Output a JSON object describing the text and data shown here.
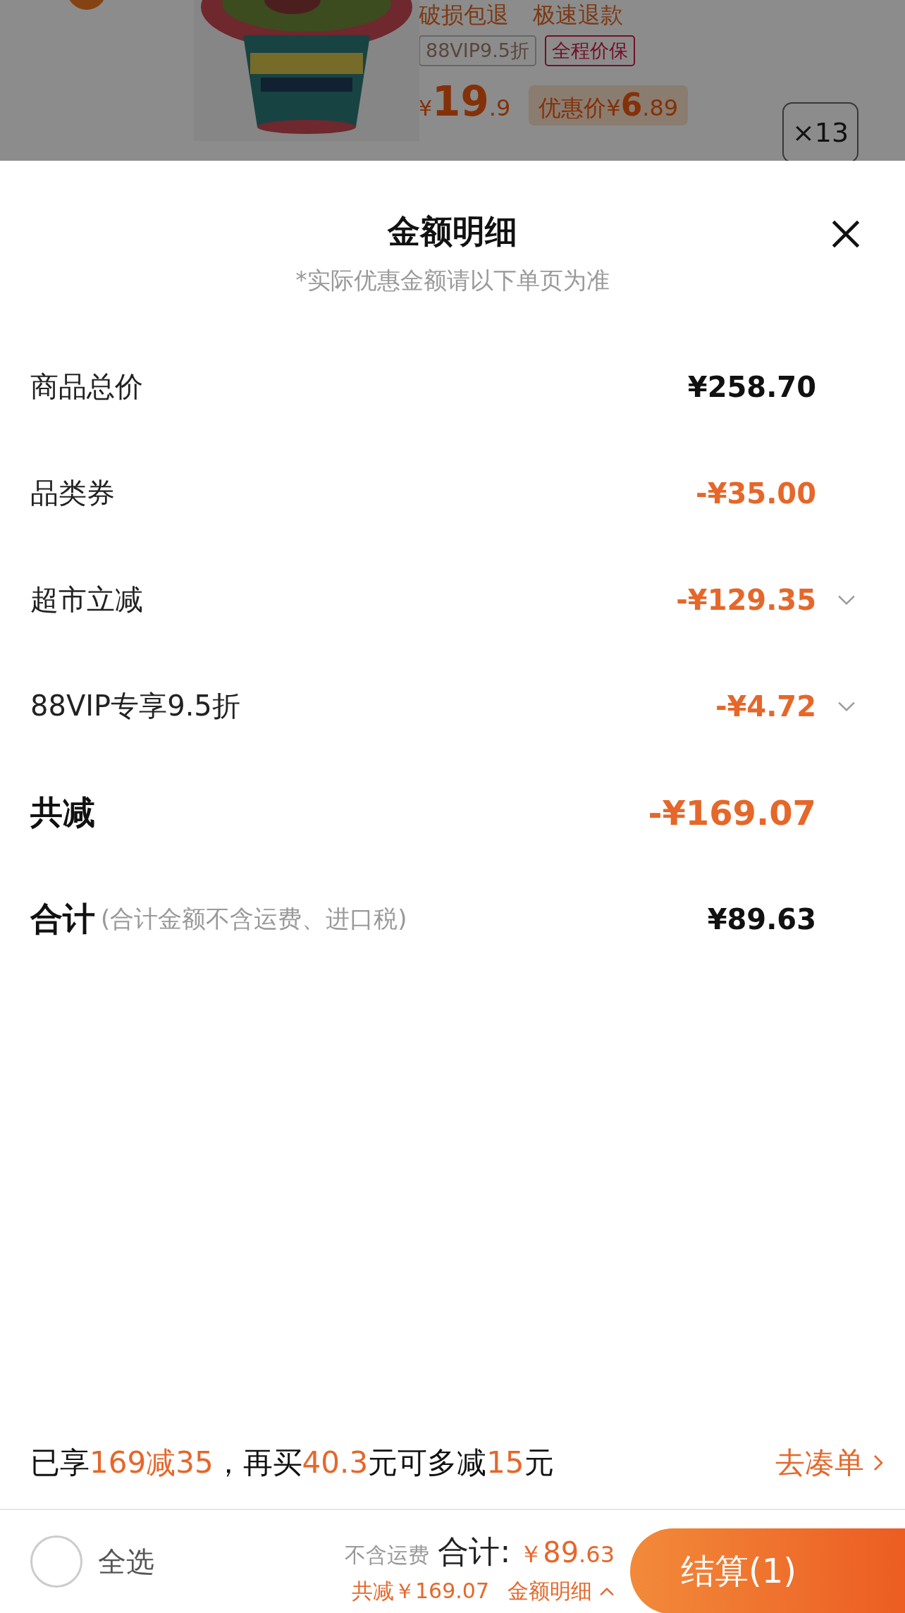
{
  "background_page": {
    "service_tags": [
      "破损包退",
      "极速退款"
    ],
    "badges": [
      {
        "text": "88VIP9.5折",
        "kind": "vip"
      },
      {
        "text": "全程价保",
        "kind": "guarantee"
      }
    ],
    "price": {
      "currency": "¥",
      "integer": "19",
      "decimal": ".9"
    },
    "discount_price": {
      "label": "优惠价",
      "currency": "¥",
      "integer": "6",
      "decimal": ".89"
    },
    "quantity": "×13"
  },
  "sheet": {
    "title": "金额明细",
    "subtitle": "*实际优惠金额请以下单页为准",
    "rows": [
      {
        "label": "商品总价",
        "value": "¥258.70",
        "kind": "price",
        "expandable": false
      },
      {
        "label": "品类券",
        "value": "-¥35.00",
        "kind": "discount",
        "expandable": false
      },
      {
        "label": "超市立减",
        "value": "-¥129.35",
        "kind": "discount",
        "expandable": true
      },
      {
        "label": "88VIP专享9.5折",
        "value": "-¥4.72",
        "kind": "discount",
        "expandable": true
      },
      {
        "label": "共减",
        "value": "-¥169.07",
        "kind": "total_discount",
        "expandable": false
      },
      {
        "label": "合计",
        "note": "(合计金额不含运费、进口税)",
        "value": "¥89.63",
        "kind": "total",
        "expandable": false
      }
    ]
  },
  "promo": {
    "segments": [
      {
        "text": "已享",
        "highlight": false
      },
      {
        "text": "169减35",
        "highlight": true
      },
      {
        "text": "，再买",
        "highlight": false
      },
      {
        "text": "40.3",
        "highlight": true
      },
      {
        "text": "元可多减",
        "highlight": false
      },
      {
        "text": "15",
        "highlight": true
      },
      {
        "text": "元",
        "highlight": false
      }
    ],
    "link": "去凑单"
  },
  "bottom_bar": {
    "select_all": {
      "label": "全选",
      "checked": false
    },
    "shipping_note": "不含运费",
    "total_label": "合计:",
    "total_currency": "￥",
    "total_integer": "89",
    "total_decimal": ".63",
    "saved": "共减￥169.07",
    "details_link": {
      "label": "金额明细",
      "expanded": true
    },
    "checkout": "结算(1)"
  }
}
